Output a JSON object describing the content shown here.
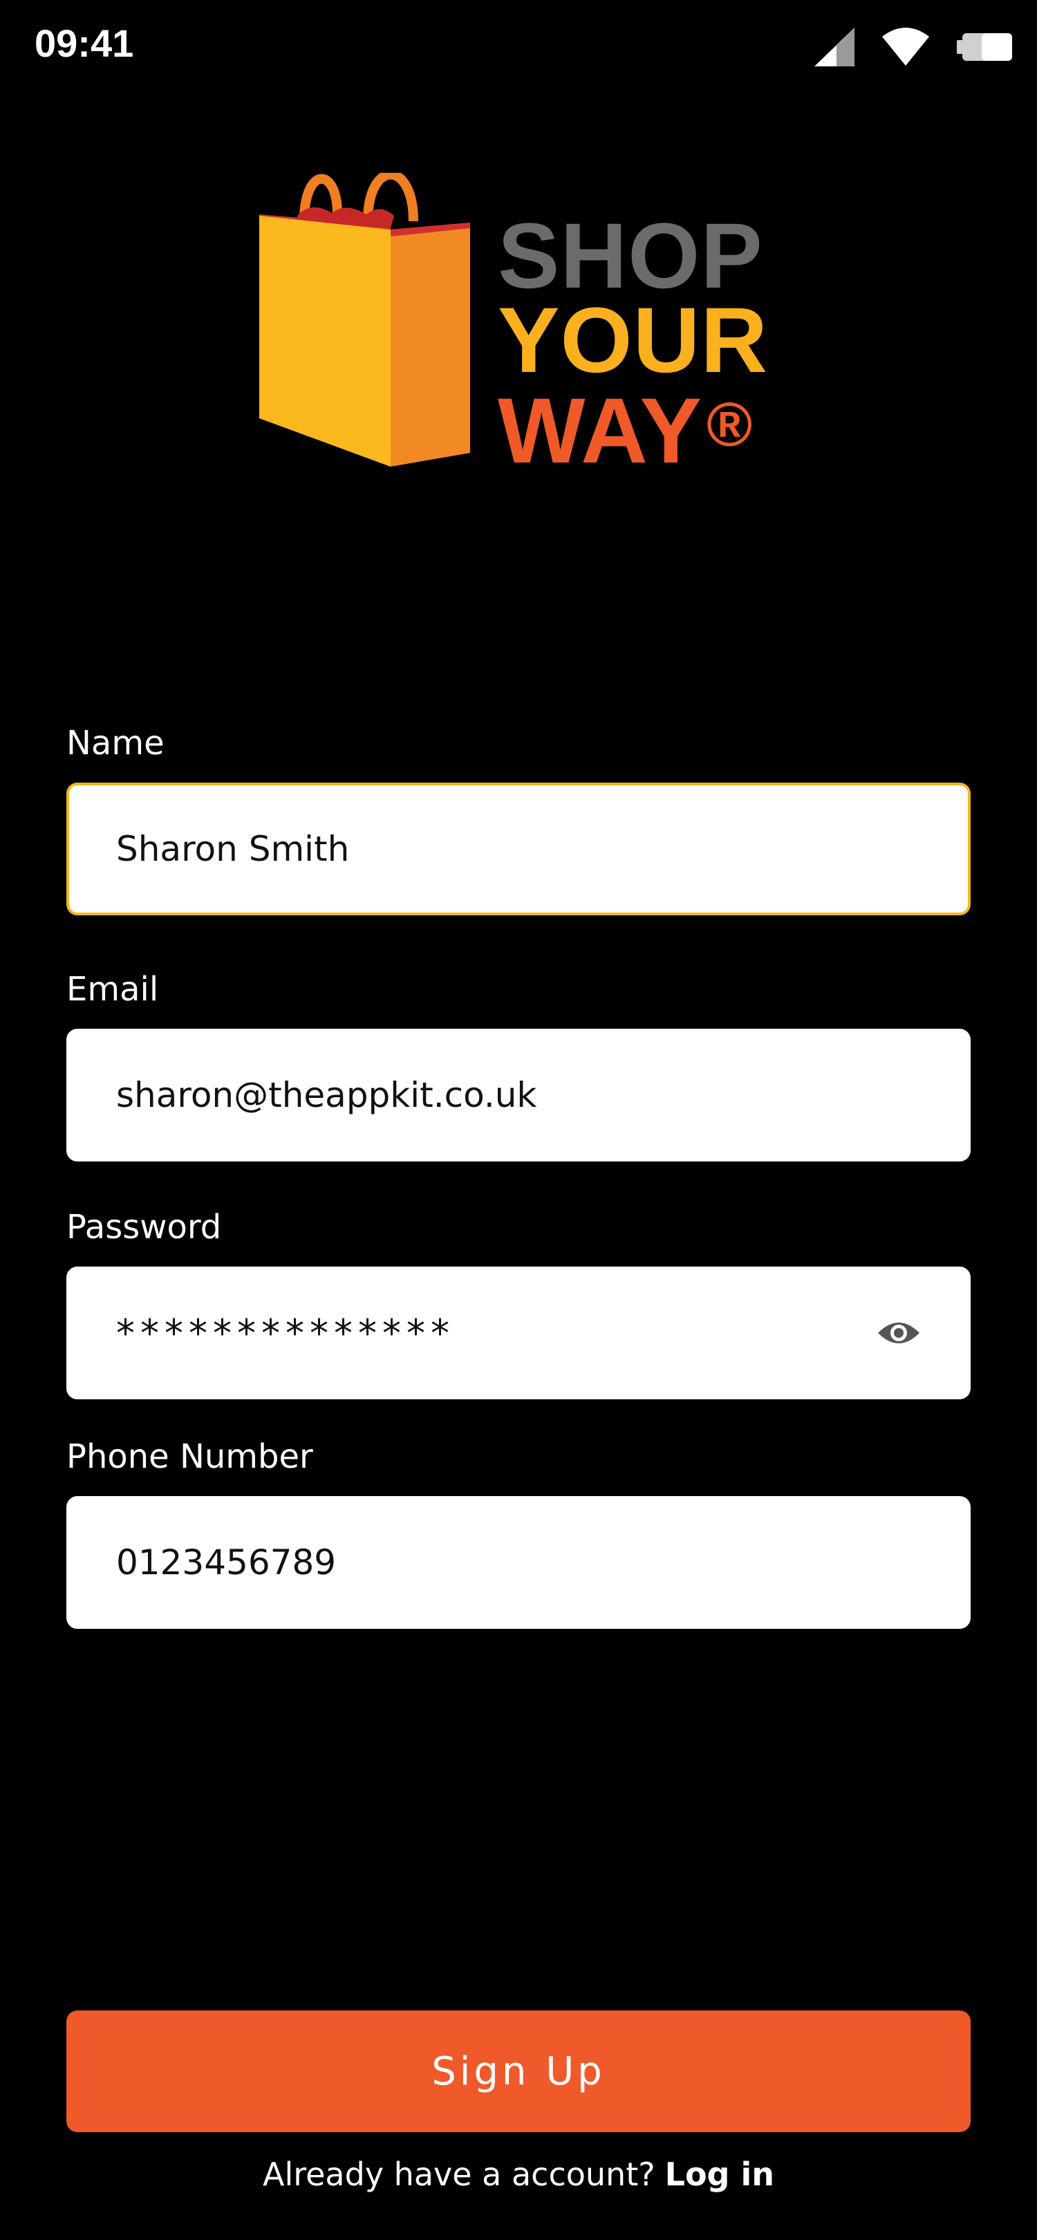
{
  "status_bar": {
    "time": "09:41",
    "icons": [
      "signal-icon",
      "wifi-icon",
      "battery-icon"
    ]
  },
  "logo": {
    "line1": "SHOP",
    "line2": "YOUR",
    "line3": "WAY",
    "registered": "®",
    "colors": {
      "shop": "#6b6b6b",
      "your": "#fbb01f",
      "way": "#f05a28"
    }
  },
  "form": {
    "name": {
      "label": "Name",
      "value": "Sharon Smith",
      "focused": true
    },
    "email": {
      "label": "Email",
      "value": "sharon@theappkit.co.uk"
    },
    "password": {
      "label": "Password",
      "value": "**************",
      "toggle_icon": "eye-icon"
    },
    "phone": {
      "label": "Phone Number",
      "value": "0123456789"
    }
  },
  "actions": {
    "signup_label": "Sign Up",
    "login_prompt": "Already have a account?",
    "login_link": "Log in"
  },
  "colors": {
    "background": "#000000",
    "accent": "#f05a2b",
    "focus_border": "#f3b71d"
  }
}
